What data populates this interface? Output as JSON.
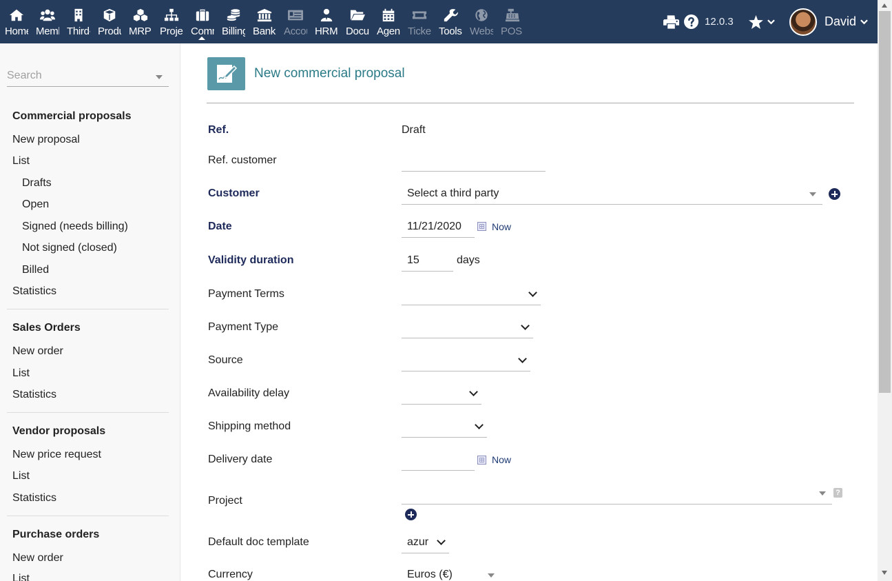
{
  "topbar": {
    "menu": [
      {
        "label": "Home",
        "icon": "home-icon"
      },
      {
        "label": "Members",
        "icon": "members-icon"
      },
      {
        "label": "Third-parties",
        "icon": "building-icon"
      },
      {
        "label": "Products",
        "icon": "cube-icon"
      },
      {
        "label": "MRP",
        "icon": "cubes-icon"
      },
      {
        "label": "Projects",
        "icon": "sitemap-icon"
      },
      {
        "label": "Commercial",
        "icon": "suitcase-icon"
      },
      {
        "label": "Billing",
        "icon": "coins-icon"
      },
      {
        "label": "Bank",
        "icon": "bank-icon"
      },
      {
        "label": "Accounting",
        "icon": "money-check-icon"
      },
      {
        "label": "HRM",
        "icon": "user-tie-icon"
      },
      {
        "label": "Documents",
        "icon": "folder-icon"
      },
      {
        "label": "Agenda",
        "icon": "calendar-icon"
      },
      {
        "label": "Tickets",
        "icon": "ticket-icon"
      },
      {
        "label": "Tools",
        "icon": "wrench-icon"
      },
      {
        "label": "Websites",
        "icon": "globe-icon"
      },
      {
        "label": "POS",
        "icon": "cash-register-icon"
      }
    ],
    "version": "12.0.3",
    "user": "David"
  },
  "sidebar": {
    "search_placeholder": "Search",
    "items": [
      {
        "label": "Commercial proposals"
      },
      {
        "label": "New proposal"
      },
      {
        "label": "List"
      },
      {
        "label": "Drafts"
      },
      {
        "label": "Open"
      },
      {
        "label": "Signed (needs billing)"
      },
      {
        "label": "Not signed (closed)"
      },
      {
        "label": "Billed"
      },
      {
        "label": "Statistics"
      },
      {
        "label": "Sales Orders"
      },
      {
        "label": "New order"
      },
      {
        "label": "List"
      },
      {
        "label": "Statistics"
      },
      {
        "label": "Vendor proposals"
      },
      {
        "label": "New price request"
      },
      {
        "label": "List"
      },
      {
        "label": "Statistics"
      },
      {
        "label": "Purchase orders"
      },
      {
        "label": "New order"
      },
      {
        "label": "List"
      }
    ]
  },
  "main": {
    "title": "New commercial proposal",
    "form": {
      "ref_label": "Ref.",
      "ref_value": "Draft",
      "ref_customer_label": "Ref. customer",
      "ref_customer_value": "",
      "customer_label": "Customer",
      "customer_value": "Select a third party",
      "date_label": "Date",
      "date_value": "11/21/2020",
      "now_label": "Now",
      "validity_label": "Validity duration",
      "validity_value": "15",
      "validity_unit": "days",
      "payment_terms_label": "Payment Terms",
      "payment_terms_value": "",
      "payment_type_label": "Payment Type",
      "payment_type_value": "",
      "source_label": "Source",
      "source_value": "",
      "availability_label": "Availability delay",
      "availability_value": "",
      "shipping_label": "Shipping method",
      "shipping_value": "",
      "delivery_label": "Delivery date",
      "delivery_value": "",
      "project_label": "Project",
      "project_value": "",
      "help_glyph": "?",
      "doc_template_label": "Default doc template",
      "doc_template_value": "azur",
      "currency_label": "Currency",
      "currency_value": "Euros (€)"
    }
  }
}
